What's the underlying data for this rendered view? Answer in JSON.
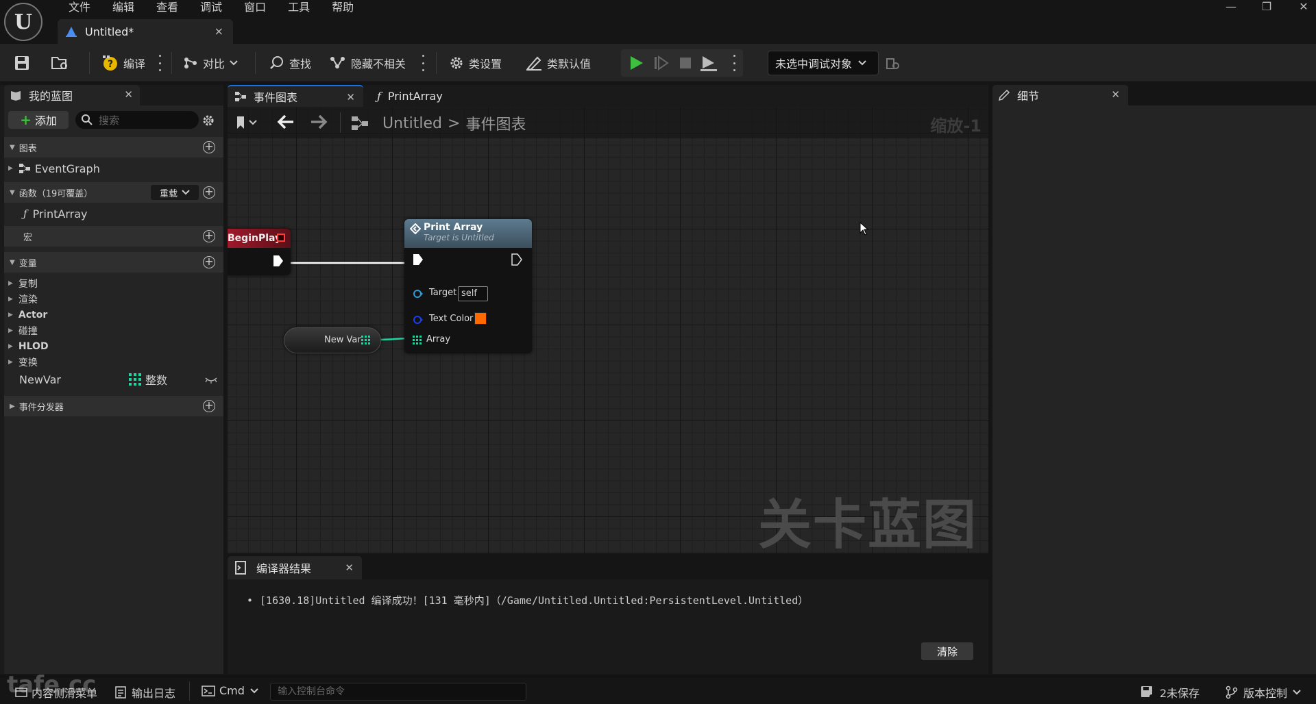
{
  "window": {
    "tab_title": "Untitled*",
    "tab_close": "×"
  },
  "menu": [
    "文件",
    "编辑",
    "查看",
    "调试",
    "窗口",
    "工具",
    "帮助"
  ],
  "toolbar": {
    "compile": "编译",
    "diff": "对比",
    "find": "查找",
    "hide_unrelated": "隐藏不相关",
    "class_settings": "类设置",
    "class_defaults": "类默认值",
    "debug_target": "未选中调试对象"
  },
  "my_blueprint": {
    "tab_label": "我的蓝图",
    "add_label": "添加",
    "search_placeholder": "搜索",
    "sections": {
      "graphs": "图表",
      "functions": "函数（19可覆盖）",
      "override": "重载",
      "macros": "宏",
      "variables": "变量",
      "event_dispatchers": "事件分发器"
    },
    "graph_items": [
      "EventGraph"
    ],
    "function_items": [
      "PrintArray"
    ],
    "variable_categories": [
      "复制",
      "渲染",
      "Actor",
      "碰撞",
      "HLOD",
      "变换"
    ],
    "variables": [
      {
        "name": "NewVar",
        "type": "整数",
        "type_color": "#1fd6a0"
      }
    ]
  },
  "graph": {
    "tabs": [
      {
        "label": "事件图表",
        "active": true
      },
      {
        "label": "PrintArray",
        "active": false
      }
    ],
    "breadcrumb": {
      "root": "Untitled",
      "separator": ">",
      "current": "事件图表"
    },
    "zoom": "缩放-1",
    "watermark": "关卡蓝图",
    "nodes": {
      "begin_play": {
        "title": "BeginPlay"
      },
      "print_array": {
        "title": "Print Array",
        "subtitle": "Target is Untitled",
        "pins": {
          "target": "Target",
          "target_value": "self",
          "text_color": "Text Color",
          "array": "Array"
        },
        "text_color_value": "#ff6a00"
      },
      "new_var": {
        "title": "New Var"
      }
    }
  },
  "compiler_results": {
    "tab_label": "编译器结果",
    "message": "[1630.18]Untitled 编译成功！[131 毫秒内]（/Game/Untitled.Untitled:PersistentLevel.Untitled）",
    "clear_label": "清除"
  },
  "details": {
    "tab_label": "细节"
  },
  "statusbar": {
    "content_drawer": "内容侧滑菜单",
    "output_log": "输出日志",
    "cmd": "Cmd",
    "console_placeholder": "输入控制台命令",
    "unsaved": "2未保存",
    "source_control": "版本控制"
  },
  "watermark_logo": "tafe.cc",
  "colors": {
    "accent_blue": "#1473e6",
    "play_green": "#3fbf3f",
    "exec_wire": "#ffffff",
    "array_wire": "#1fd6a0"
  }
}
